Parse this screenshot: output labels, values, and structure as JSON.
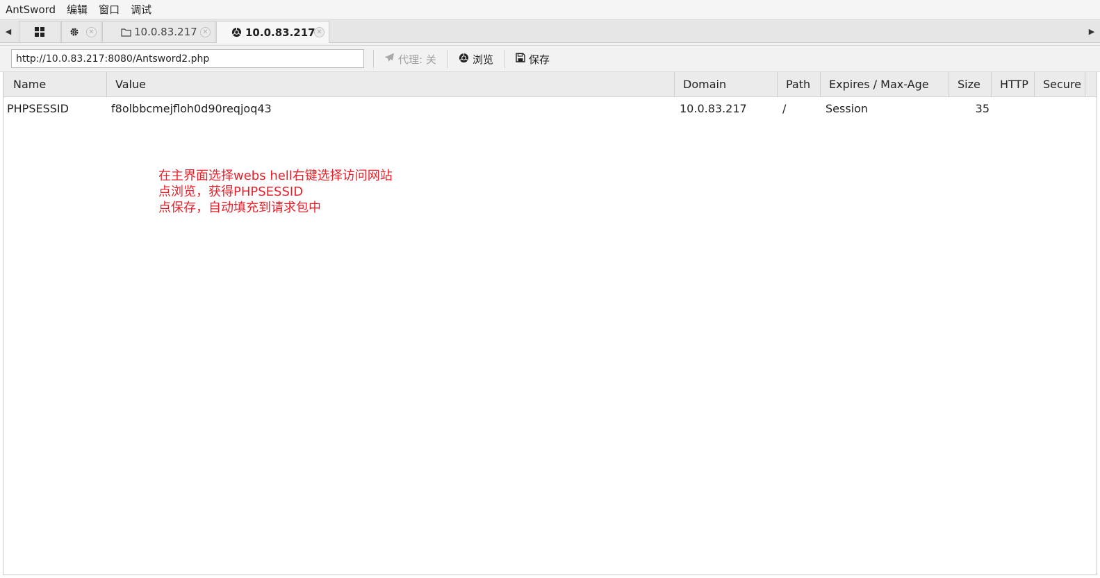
{
  "menubar": {
    "items": [
      "AntSword",
      "编辑",
      "窗口",
      "调试"
    ]
  },
  "tabs": [
    {
      "label": "",
      "icon": "grid-icon",
      "closable": false
    },
    {
      "label": "",
      "icon": "gear-icon",
      "closable": true
    },
    {
      "label": "10.0.83.217",
      "icon": "folder-icon",
      "closable": true
    },
    {
      "label": "10.0.83.217",
      "icon": "chrome-icon",
      "closable": true,
      "active": true
    }
  ],
  "toolbar": {
    "url": "http://10.0.83.217:8080/Antsword2.php",
    "proxy_label": "代理: 关",
    "browse_label": "浏览",
    "save_label": "保存"
  },
  "cookie_table": {
    "columns": [
      "Name",
      "Value",
      "Domain",
      "Path",
      "Expires / Max-Age",
      "Size",
      "HTTP",
      "Secure"
    ],
    "rows": [
      {
        "name": "PHPSESSID",
        "value": "f8olbbcmejfloh0d90reqjoq43",
        "domain": "10.0.83.217",
        "path": "/",
        "expires": "Session",
        "size": "35",
        "http": "",
        "secure": ""
      }
    ]
  },
  "annotation": {
    "lines": [
      "在主界面选择webs hell右键选择访问网站",
      "点浏览，获得PHPSESSID",
      "点保存，自动填充到请求包中"
    ],
    "color": "#e8202a"
  }
}
